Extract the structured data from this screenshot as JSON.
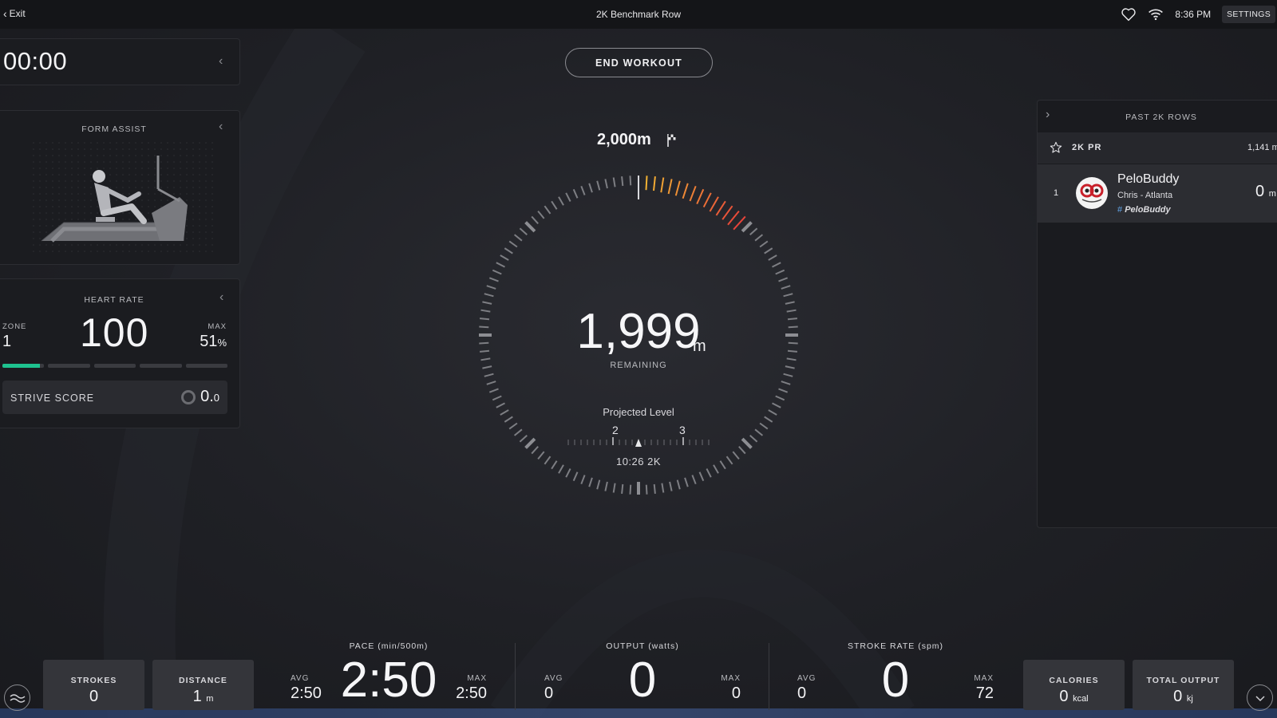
{
  "topbar": {
    "exit_label": "Exit",
    "title": "2K Benchmark Row",
    "time": "8:36 PM",
    "settings_label": "SETTINGS"
  },
  "timer": {
    "value": "00:00"
  },
  "form_assist": {
    "title": "FORM ASSIST"
  },
  "heart_rate": {
    "title": "HEART RATE",
    "zone_label": "ZONE",
    "zone_value": "1",
    "bpm": "100",
    "max_label": "MAX",
    "max_value": "51",
    "max_unit": "%",
    "zone_fill": [
      0.9,
      0,
      0,
      0,
      0
    ],
    "strive_label": "STRIVE SCORE",
    "strive_value": "0.",
    "strive_decimal": "0"
  },
  "center": {
    "end_workout_label": "END WORKOUT",
    "target_distance": "2,000m",
    "remaining_value": "1,999",
    "remaining_unit": "m",
    "remaining_label": "REMAINING",
    "progress_fraction": 0.0005,
    "projected_label": "Projected Level",
    "level_low": "2",
    "level_high": "3",
    "projected_time": "10:26 2K"
  },
  "leaderboard": {
    "title": "PAST 2K ROWS",
    "pr_label": "2K PR",
    "pr_value": "1,141 m",
    "entries": [
      {
        "rank": "1",
        "name": "PeloBuddy",
        "location": "Chris - Atlanta",
        "tag": "PeloBuddy",
        "distance": "0",
        "distance_unit": "m"
      }
    ]
  },
  "bottom": {
    "strokes": {
      "label": "STROKES",
      "value": "0"
    },
    "distance": {
      "label": "DISTANCE",
      "value": "1",
      "unit": "m"
    },
    "pace": {
      "title": "PACE (min/500m)",
      "avg_label": "AVG",
      "avg": "2:50",
      "current": "2:50",
      "max_label": "MAX",
      "max": "2:50"
    },
    "output": {
      "title": "OUTPUT (watts)",
      "avg_label": "AVG",
      "avg": "0",
      "current": "0",
      "max_label": "MAX",
      "max": "0"
    },
    "stroke_rate": {
      "title": "STROKE RATE (spm)",
      "avg_label": "AVG",
      "avg": "0",
      "current": "0",
      "max_label": "MAX",
      "max": "72"
    },
    "calories": {
      "label": "CALORIES",
      "value": "0",
      "unit": "kcal"
    },
    "total_output": {
      "label": "TOTAL OUTPUT",
      "value": "0",
      "unit": "kj"
    }
  },
  "colors": {
    "accent_green": "#1ec28f",
    "dial_warm_start": "#f2b233",
    "dial_warm_end": "#e8443a",
    "tag_hash": "#63a6e8"
  }
}
